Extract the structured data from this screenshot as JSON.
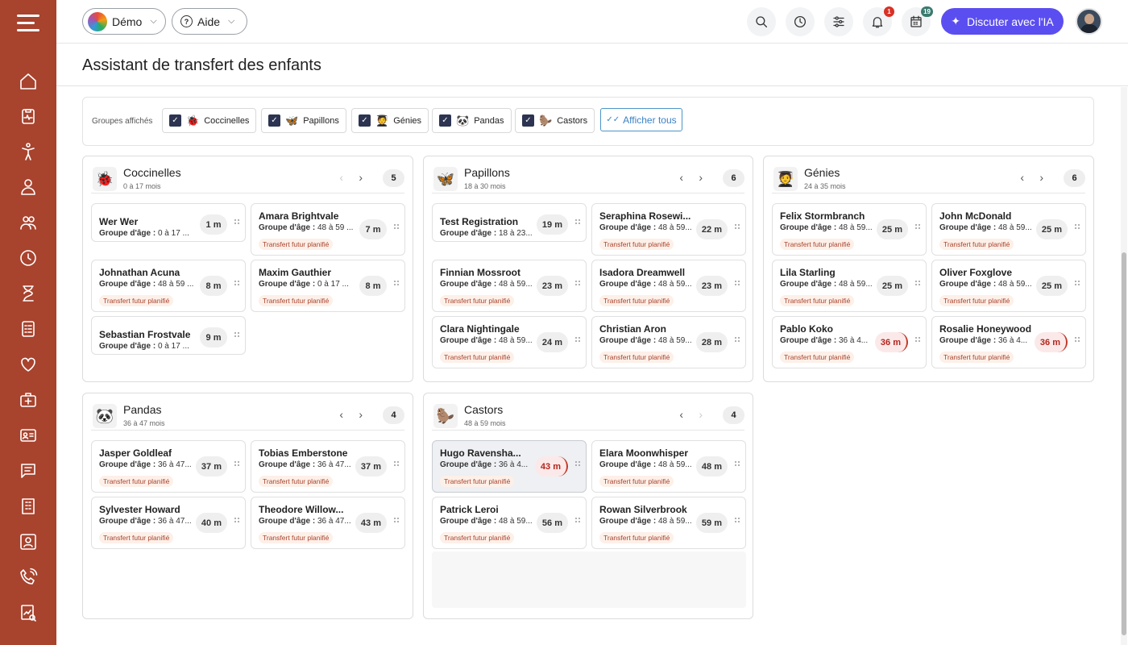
{
  "topbar": {
    "workspace_label": "Démo",
    "help_label": "Aide",
    "notifications_count": "1",
    "calendar_count": "19",
    "ai_button_label": "Discuter avec l'IA"
  },
  "page": {
    "title": "Assistant de transfert des enfants"
  },
  "filters": {
    "label": "Groupes affichés",
    "items": [
      {
        "name": "Coccinelles",
        "emoji": "🐞"
      },
      {
        "name": "Papillons",
        "emoji": "🦋"
      },
      {
        "name": "Génies",
        "emoji": "🧑‍🎓"
      },
      {
        "name": "Pandas",
        "emoji": "🐼"
      },
      {
        "name": "Castors",
        "emoji": "🦫"
      }
    ],
    "show_all_label": "Afficher tous"
  },
  "labels": {
    "age_group_prefix": "Groupe d'âge :",
    "future_transfer": "Transfert futur planifié"
  },
  "groups": [
    {
      "name": "Coccinelles",
      "emoji": "🐞",
      "age": "0 à 17 mois",
      "count": "5",
      "children": [
        {
          "name": "Wer Wer",
          "age": "0 à 17 ...",
          "minutes": "1 m",
          "transfer": false
        },
        {
          "name": "Amara Brightvale",
          "age": "48 à 59 ...",
          "minutes": "7 m",
          "transfer": true
        },
        {
          "name": "Johnathan Acuna",
          "age": "48 à 59 ...",
          "minutes": "8 m",
          "transfer": true
        },
        {
          "name": "Maxim Gauthier",
          "age": "0 à 17 ...",
          "minutes": "8 m",
          "transfer": true
        },
        {
          "name": "Sebastian Frostvale",
          "age": "0 à 17 ...",
          "minutes": "9 m",
          "transfer": false
        }
      ]
    },
    {
      "name": "Papillons",
      "emoji": "🦋",
      "age": "18 à 30 mois",
      "count": "6",
      "children": [
        {
          "name": "Test Registration",
          "age": "18 à 23...",
          "minutes": "19 m",
          "transfer": false
        },
        {
          "name": "Seraphina Rosewi...",
          "age": "48 à 59...",
          "minutes": "22 m",
          "transfer": true
        },
        {
          "name": "Finnian Mossroot",
          "age": "48 à 59...",
          "minutes": "23 m",
          "transfer": true
        },
        {
          "name": "Isadora Dreamwell",
          "age": "48 à 59...",
          "minutes": "23 m",
          "transfer": true
        },
        {
          "name": "Clara Nightingale",
          "age": "48 à 59...",
          "minutes": "24 m",
          "transfer": true
        },
        {
          "name": "Christian Aron",
          "age": "48 à 59...",
          "minutes": "28 m",
          "transfer": true
        }
      ]
    },
    {
      "name": "Génies",
      "emoji": "🧑‍🎓",
      "age": "24 à 35 mois",
      "count": "6",
      "children": [
        {
          "name": "Felix Stormbranch",
          "age": "48 à 59...",
          "minutes": "25 m",
          "transfer": true
        },
        {
          "name": "John McDonald",
          "age": "48 à 59...",
          "minutes": "25 m",
          "transfer": true
        },
        {
          "name": "Lila Starling",
          "age": "48 à 59...",
          "minutes": "25 m",
          "transfer": true
        },
        {
          "name": "Oliver Foxglove",
          "age": "48 à 59...",
          "minutes": "25 m",
          "transfer": true
        },
        {
          "name": "Pablo Koko",
          "age": "36 à 4...",
          "minutes": "36 m",
          "transfer": true,
          "warn": true
        },
        {
          "name": "Rosalie Honeywood",
          "age": "36 à 4...",
          "minutes": "36 m",
          "transfer": true,
          "warn": true
        }
      ]
    },
    {
      "name": "Pandas",
      "emoji": "🐼",
      "age": "36 à 47 mois",
      "count": "4",
      "children": [
        {
          "name": "Jasper Goldleaf",
          "age": "36 à 47...",
          "minutes": "37 m",
          "transfer": true
        },
        {
          "name": "Tobias Emberstone",
          "age": "36 à 47...",
          "minutes": "37 m",
          "transfer": true
        },
        {
          "name": "Sylvester Howard",
          "age": "36 à 47...",
          "minutes": "40 m",
          "transfer": true
        },
        {
          "name": "Theodore Willow...",
          "age": "36 à 47...",
          "minutes": "43 m",
          "transfer": true
        }
      ]
    },
    {
      "name": "Castors",
      "emoji": "🦫",
      "age": "48 à 59 mois",
      "count": "4",
      "children": [
        {
          "name": "Hugo Ravensha...",
          "age": "36 à 4...",
          "minutes": "43 m",
          "transfer": true,
          "warn": true,
          "selected": true
        },
        {
          "name": "Elara Moonwhisper",
          "age": "48 à 59...",
          "minutes": "48 m",
          "transfer": true
        },
        {
          "name": "Patrick Leroi",
          "age": "48 à 59...",
          "minutes": "56 m",
          "transfer": true
        },
        {
          "name": "Rowan Silverbrook",
          "age": "48 à 59...",
          "minutes": "59 m",
          "transfer": true
        }
      ]
    }
  ]
}
